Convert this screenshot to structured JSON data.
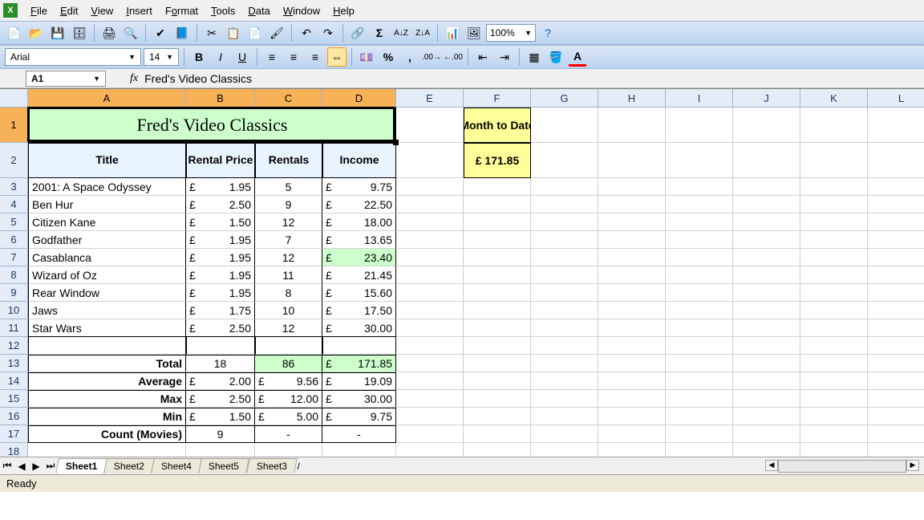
{
  "menu": {
    "items": [
      "File",
      "Edit",
      "View",
      "Insert",
      "Format",
      "Tools",
      "Data",
      "Window",
      "Help"
    ],
    "mnemonics": [
      "F",
      "E",
      "V",
      "I",
      "o",
      "T",
      "D",
      "W",
      "H"
    ]
  },
  "toolbar1": {
    "zoom": "100%"
  },
  "toolbar2": {
    "font_name": "Arial",
    "font_size": "14"
  },
  "namebox": "A1",
  "formula": "Fred's Video Classics",
  "col_widths": {
    "A": 197,
    "B": 86,
    "C": 84,
    "D": 92,
    "E": 84,
    "F": 84,
    "G": 84,
    "H": 84,
    "I": 84,
    "J": 84,
    "K": 84,
    "L": 84
  },
  "cols": [
    "A",
    "B",
    "C",
    "D",
    "E",
    "F",
    "G",
    "H",
    "I",
    "J",
    "K",
    "L"
  ],
  "selected_cols": [
    "A",
    "B",
    "C",
    "D"
  ],
  "rows_shown": 18,
  "title": "Fred's Video Classics",
  "headers": {
    "A": "Title",
    "B": "Rental Price",
    "C": "Rentals",
    "D": "Income"
  },
  "month_to_date": {
    "label": "Month to Date",
    "value": "£ 171.85"
  },
  "data_rows": [
    {
      "title": "2001: A Space Odyssey",
      "price": "1.95",
      "rentals": "5",
      "income": "9.75"
    },
    {
      "title": "Ben Hur",
      "price": "2.50",
      "rentals": "9",
      "income": "22.50"
    },
    {
      "title": "Citizen Kane",
      "price": "1.50",
      "rentals": "12",
      "income": "18.00"
    },
    {
      "title": "Godfather",
      "price": "1.95",
      "rentals": "7",
      "income": "13.65"
    },
    {
      "title": "Casablanca",
      "price": "1.95",
      "rentals": "12",
      "income": "23.40"
    },
    {
      "title": "Wizard of Oz",
      "price": "1.95",
      "rentals": "11",
      "income": "21.45"
    },
    {
      "title": "Rear Window",
      "price": "1.95",
      "rentals": "8",
      "income": "15.60"
    },
    {
      "title": "Jaws",
      "price": "1.75",
      "rentals": "10",
      "income": "17.50"
    },
    {
      "title": "Star Wars",
      "price": "2.50",
      "rentals": "12",
      "income": "30.00"
    }
  ],
  "summary": [
    {
      "label": "Total",
      "b": "18",
      "c": "86",
      "d": "171.85",
      "b_money": false,
      "hl": true
    },
    {
      "label": "Average",
      "b": "2.00",
      "c": "9.56",
      "d": "19.09",
      "b_money": true
    },
    {
      "label": "Max",
      "b": "2.50",
      "c": "12.00",
      "d": "30.00",
      "b_money": true
    },
    {
      "label": "Min",
      "b": "1.50",
      "c": "5.00",
      "d": "9.75",
      "b_money": true
    },
    {
      "label": "Count (Movies)",
      "b": "9",
      "c": "-",
      "d": "-",
      "b_money": false
    }
  ],
  "sheet_tabs": [
    "Sheet1",
    "Sheet2",
    "Sheet4",
    "Sheet5",
    "Sheet3"
  ],
  "active_sheet": "Sheet1",
  "status": "Ready"
}
